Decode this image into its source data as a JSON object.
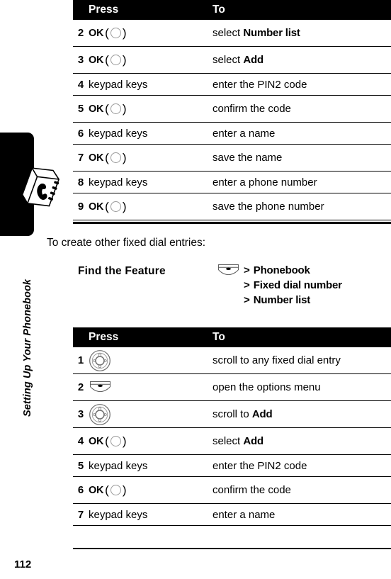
{
  "sidebar": {
    "running_head": "Setting Up Your Phonebook",
    "tab_icon": "phonebook-icon"
  },
  "footer": {
    "page_number": "112"
  },
  "table1": {
    "headers": {
      "num": "",
      "press": "Press",
      "to": "To"
    },
    "rows": [
      {
        "num": "2",
        "press_type": "okkey",
        "press": "OK",
        "to_prefix": "select ",
        "to_term": "Number list",
        "to_suffix": ""
      },
      {
        "num": "3",
        "press_type": "okkey",
        "press": "OK",
        "to_prefix": "select ",
        "to_term": "Add",
        "to_suffix": ""
      },
      {
        "num": "4",
        "press_type": "text",
        "press": "keypad keys",
        "to_prefix": "enter the PIN2 code",
        "to_term": "",
        "to_suffix": ""
      },
      {
        "num": "5",
        "press_type": "okkey",
        "press": "OK",
        "to_prefix": "confirm the code",
        "to_term": "",
        "to_suffix": ""
      },
      {
        "num": "6",
        "press_type": "text",
        "press": "keypad keys",
        "to_prefix": "enter a name",
        "to_term": "",
        "to_suffix": ""
      },
      {
        "num": "7",
        "press_type": "okkey",
        "press": "OK",
        "to_prefix": "save the name",
        "to_term": "",
        "to_suffix": ""
      },
      {
        "num": "8",
        "press_type": "text",
        "press": "keypad keys",
        "to_prefix": "enter a phone number",
        "to_term": "",
        "to_suffix": ""
      },
      {
        "num": "9",
        "press_type": "okkey",
        "press": "OK",
        "to_prefix": "save the phone number",
        "to_term": "",
        "to_suffix": ""
      }
    ]
  },
  "intro": {
    "text": "To create other fixed dial entries:"
  },
  "find_the_feature": {
    "label": "Find the Feature",
    "icon": "menu-key-icon",
    "path": [
      {
        "separator": ">",
        "item": "Phonebook"
      },
      {
        "separator": ">",
        "item": "Fixed dial number"
      },
      {
        "separator": ">",
        "item": "Number list"
      }
    ]
  },
  "table2": {
    "headers": {
      "num": "",
      "press": "Press",
      "to": "To"
    },
    "rows": [
      {
        "num": "1",
        "press_type": "navwheel",
        "press": "",
        "to_prefix": "scroll to any fixed dial entry",
        "to_term": "",
        "to_suffix": ""
      },
      {
        "num": "2",
        "press_type": "menukey",
        "press": "",
        "to_prefix": "open the options menu",
        "to_term": "",
        "to_suffix": ""
      },
      {
        "num": "3",
        "press_type": "navwheel",
        "press": "",
        "to_prefix": "scroll to ",
        "to_term": "Add",
        "to_suffix": ""
      },
      {
        "num": "4",
        "press_type": "okkey",
        "press": "OK",
        "to_prefix": "select ",
        "to_term": "Add",
        "to_suffix": ""
      },
      {
        "num": "5",
        "press_type": "text",
        "press": "keypad keys",
        "to_prefix": "enter the PIN2 code",
        "to_term": "",
        "to_suffix": ""
      },
      {
        "num": "6",
        "press_type": "okkey",
        "press": "OK",
        "to_prefix": "confirm the code",
        "to_term": "",
        "to_suffix": ""
      },
      {
        "num": "7",
        "press_type": "text",
        "press": "keypad keys",
        "to_prefix": "enter a name",
        "to_term": "",
        "to_suffix": ""
      }
    ]
  },
  "colors": {
    "header_bg": "#000000",
    "header_text": "#ffffff",
    "rule": "#000000",
    "page_bg": "#ffffff"
  }
}
